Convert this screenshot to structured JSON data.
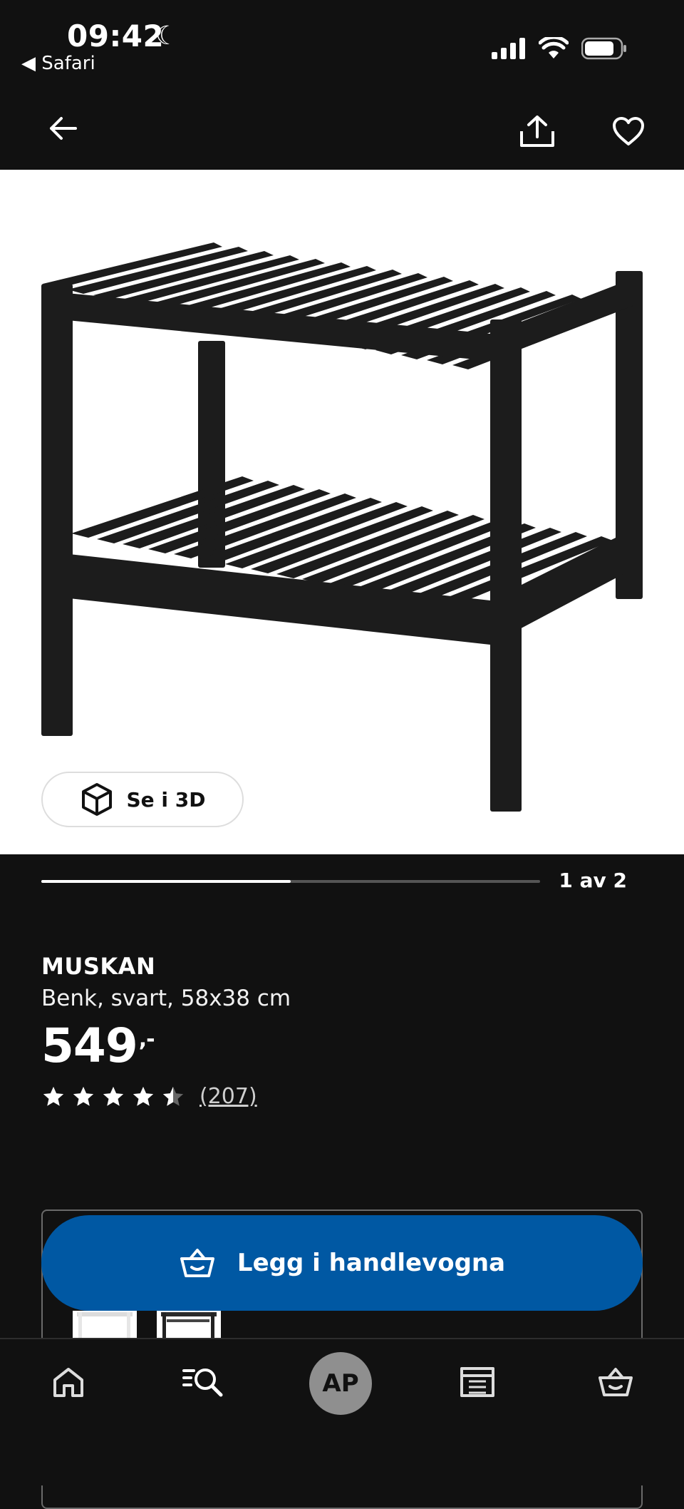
{
  "status_bar": {
    "time": "09:42",
    "back_app": "Safari"
  },
  "header": {
    "back_icon": "arrow-left-icon",
    "share_icon": "share-icon",
    "favorite_icon": "heart-icon"
  },
  "gallery": {
    "view_3d_label": "Se i 3D",
    "page_indicator": "1 av 2",
    "progress_fraction": 0.5
  },
  "product": {
    "name": "MUSKAN",
    "description": "Benk, svart, 58x38 cm",
    "price": "549",
    "price_suffix": ",-",
    "rating": 4.5,
    "review_count": "(207)"
  },
  "cart_button": {
    "label": "Legg i handlevogna"
  },
  "bottom_nav": {
    "avatar_initials": "AP",
    "items": [
      "home-icon",
      "search-icon",
      "profile",
      "store-icon",
      "basket-icon"
    ]
  },
  "colors": {
    "background": "#111111",
    "accent": "#0058a3"
  }
}
